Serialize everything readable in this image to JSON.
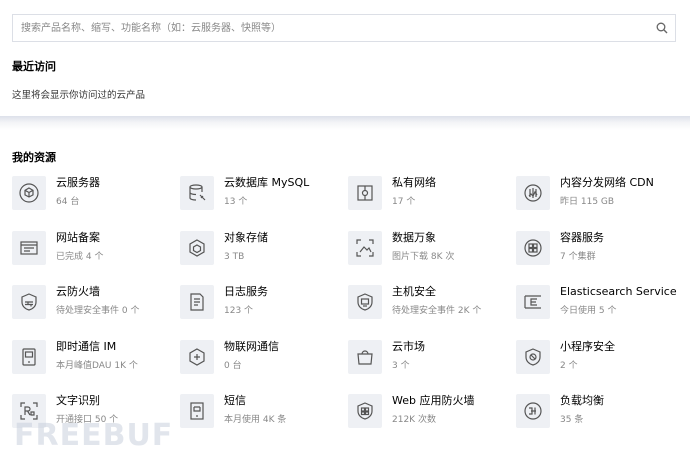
{
  "search": {
    "placeholder": "搜索产品名称、缩写、功能名称（如：云服务器、快照等）",
    "icon": "search-icon"
  },
  "recent": {
    "title": "最近访问",
    "empty_text": "这里将会显示你访问过的云产品"
  },
  "resources": {
    "title": "我的资源",
    "items": [
      {
        "name": "云服务器",
        "sub": "64 台",
        "icon": "cube-server-icon"
      },
      {
        "name": "云数据库 MySQL",
        "sub": "13 个",
        "icon": "database-icon"
      },
      {
        "name": "私有网络",
        "sub": "17 个",
        "icon": "private-network-icon"
      },
      {
        "name": "内容分发网络 CDN",
        "sub": "昨日 115 GB",
        "icon": "cdn-icon"
      },
      {
        "name": "网站备案",
        "sub": "已完成 4 个",
        "icon": "website-record-icon"
      },
      {
        "name": "对象存储",
        "sub": "3 TB",
        "icon": "object-storage-icon"
      },
      {
        "name": "数据万象",
        "sub": "图片下载 8K 次",
        "icon": "image-data-icon"
      },
      {
        "name": "容器服务",
        "sub": "7 个集群",
        "icon": "container-icon"
      },
      {
        "name": "云防火墙",
        "sub": "待处理安全事件 0 个",
        "icon": "cloud-firewall-icon"
      },
      {
        "name": "日志服务",
        "sub": "123 个",
        "icon": "log-service-icon"
      },
      {
        "name": "主机安全",
        "sub": "待处理安全事件 2K 个",
        "icon": "host-security-icon"
      },
      {
        "name": "Elasticsearch Service",
        "sub": "今日使用 5 个",
        "icon": "elasticsearch-icon"
      },
      {
        "name": "即时通信 IM",
        "sub": "本月峰值DAU 1K 个",
        "icon": "instant-messaging-icon"
      },
      {
        "name": "物联网通信",
        "sub": "0 台",
        "icon": "iot-icon"
      },
      {
        "name": "云市场",
        "sub": "3 个",
        "icon": "marketplace-icon"
      },
      {
        "name": "小程序安全",
        "sub": "2 个",
        "icon": "mini-program-security-icon"
      },
      {
        "name": "文字识别",
        "sub": "开通接口 50 个",
        "icon": "ocr-icon"
      },
      {
        "name": "短信",
        "sub": "本月使用 4K 条",
        "icon": "sms-icon"
      },
      {
        "name": "Web 应用防火墙",
        "sub": "212K 次数",
        "icon": "waf-icon"
      },
      {
        "name": "负载均衡",
        "sub": "35 条",
        "icon": "load-balancer-icon"
      }
    ]
  },
  "watermark": "FREEBUF",
  "colors": {
    "icon_bg": "#eef0f4",
    "icon_stroke": "#555555",
    "border": "#dcdfe6",
    "muted": "#888888"
  }
}
